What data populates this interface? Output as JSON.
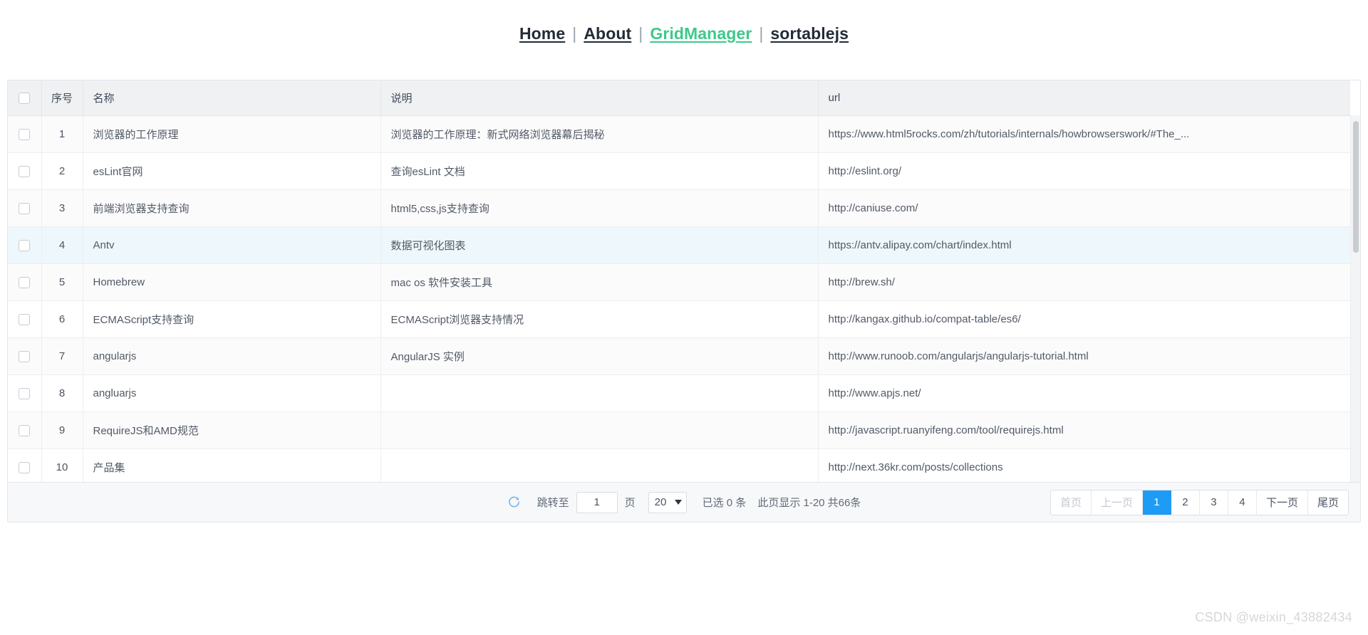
{
  "nav": {
    "separator": "|",
    "links": [
      {
        "label": "Home",
        "active": false
      },
      {
        "label": "About",
        "active": false
      },
      {
        "label": "GridManager",
        "active": true
      },
      {
        "label": "sortablejs",
        "active": false
      }
    ]
  },
  "grid": {
    "columns": [
      {
        "key": "check",
        "label": ""
      },
      {
        "key": "no",
        "label": "序号"
      },
      {
        "key": "name",
        "label": "名称"
      },
      {
        "key": "desc",
        "label": "说明"
      },
      {
        "key": "url",
        "label": "url"
      }
    ],
    "rows": [
      {
        "no": "1",
        "name": "浏览器的工作原理",
        "desc": "浏览器的工作原理：新式网络浏览器幕后揭秘",
        "url": "https://www.html5rocks.com/zh/tutorials/internals/howbrowserswork/#The_..."
      },
      {
        "no": "2",
        "name": "esLint官网",
        "desc": "查询esLint 文档",
        "url": "http://eslint.org/"
      },
      {
        "no": "3",
        "name": "前端浏览器支持查询",
        "desc": "html5,css,js支持查询",
        "url": "http://caniuse.com/"
      },
      {
        "no": "4",
        "name": "Antv",
        "desc": "数据可视化图表",
        "url": "https://antv.alipay.com/chart/index.html",
        "hover": true
      },
      {
        "no": "5",
        "name": "Homebrew",
        "desc": "mac os 软件安装工具",
        "url": "http://brew.sh/"
      },
      {
        "no": "6",
        "name": "ECMAScript支持查询",
        "desc": "ECMAScript浏览器支持情况",
        "url": "http://kangax.github.io/compat-table/es6/"
      },
      {
        "no": "7",
        "name": "angularjs",
        "desc": "AngularJS 实例",
        "url": "http://www.runoob.com/angularjs/angularjs-tutorial.html"
      },
      {
        "no": "8",
        "name": "angluarjs",
        "desc": "",
        "url": "http://www.apjs.net/"
      },
      {
        "no": "9",
        "name": "RequireJS和AMD规范",
        "desc": "",
        "url": "http://javascript.ruanyifeng.com/tool/requirejs.html"
      },
      {
        "no": "10",
        "name": "产品集",
        "desc": "",
        "url": "http://next.36kr.com/posts/collections"
      }
    ]
  },
  "footer": {
    "refresh_icon": "refresh-icon",
    "jump_label": "跳转至",
    "jump_value": "1",
    "jump_unit": "页",
    "page_size": "20",
    "selected_info": "已选 0 条",
    "page_info": "此页显示 1-20 共66条",
    "pager": [
      {
        "label": "首页",
        "state": "disabled"
      },
      {
        "label": "上一页",
        "state": "disabled"
      },
      {
        "label": "1",
        "state": "active"
      },
      {
        "label": "2",
        "state": "normal"
      },
      {
        "label": "3",
        "state": "normal"
      },
      {
        "label": "4",
        "state": "normal"
      },
      {
        "label": "下一页",
        "state": "normal"
      },
      {
        "label": "尾页",
        "state": "normal"
      }
    ]
  },
  "watermark": {
    "text": "CSDN @weixin_43882434"
  },
  "colors": {
    "accent_blue": "#1e9bf5",
    "active_link_green": "#3dc98a",
    "header_bg": "#f0f1f2",
    "row_hover": "#eef7fb"
  }
}
